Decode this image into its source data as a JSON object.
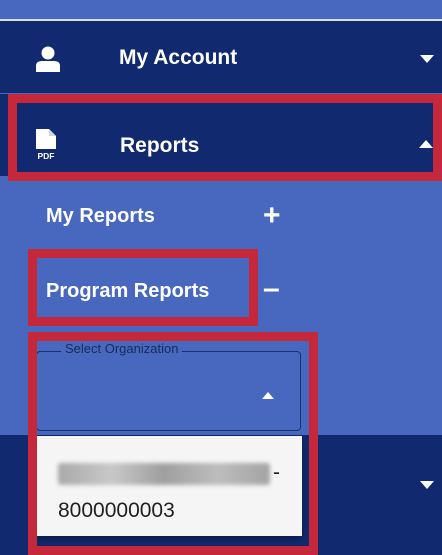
{
  "menu": {
    "my_account": {
      "label": "My Account",
      "icon": "user-icon"
    },
    "reports": {
      "label": "Reports",
      "icon": "pdf-file-icon",
      "icon_text": "PDF"
    }
  },
  "submenu": {
    "my_reports": {
      "label": "My Reports",
      "toggle": "+"
    },
    "program_reports": {
      "label": "Program Reports",
      "toggle": "–"
    }
  },
  "select_organization": {
    "legend": "Select Organization",
    "option_suffix": "-",
    "option_code": "8000000003"
  },
  "colors": {
    "nav_dark": "#11296f",
    "panel_blue": "#4868c0",
    "highlight": "#c4283a"
  }
}
